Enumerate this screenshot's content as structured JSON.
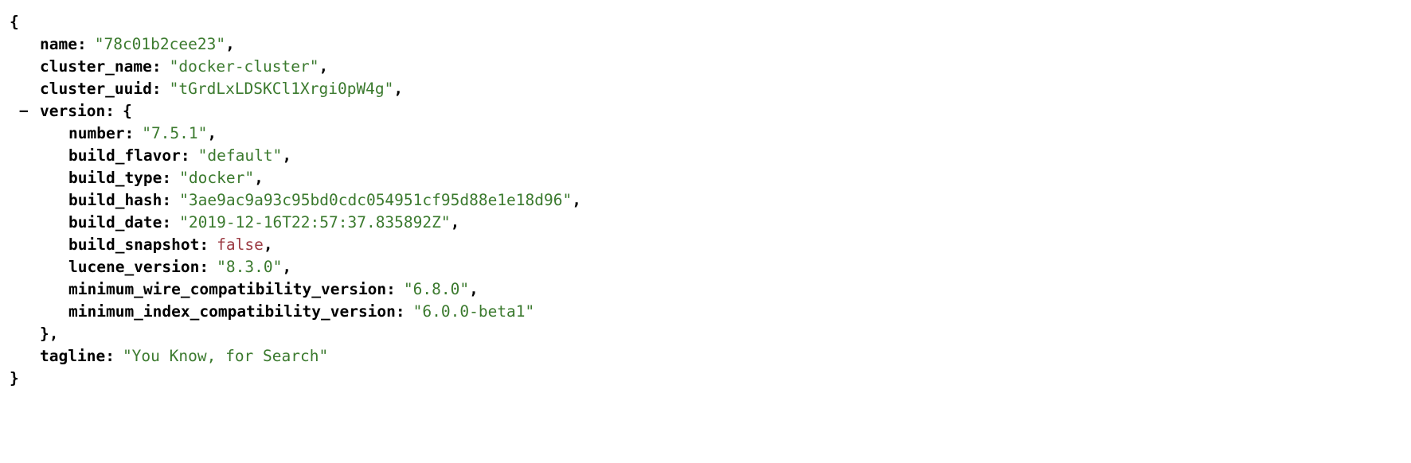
{
  "viewer": {
    "type": "json-viewer",
    "colors": {
      "background": "#ffffff",
      "key": "#000000",
      "string_value": "#3b7a2e",
      "boolean_value": "#9c3c44",
      "punctuation": "#000000"
    },
    "open_brace": "{",
    "close_brace": "}",
    "object_open": "{",
    "object_close_comma": "},",
    "collapse_toggle": "−",
    "colon": ":",
    "comma": ",",
    "quote": "\""
  },
  "document": {
    "root_open": "{",
    "root_close": "}",
    "entries": [
      {
        "key": "name",
        "value": "\"78c01b2cee23\"",
        "type": "string",
        "comma": ",",
        "indent": 1
      },
      {
        "key": "cluster_name",
        "value": "\"docker-cluster\"",
        "type": "string",
        "comma": ",",
        "indent": 1
      },
      {
        "key": "cluster_uuid",
        "value": "\"tGrdLxLDSKCl1Xrgi0pW4g\"",
        "type": "string",
        "comma": ",",
        "indent": 1
      },
      {
        "key": "version",
        "value": "{",
        "type": "object-open",
        "comma": "",
        "indent": 1,
        "toggle": "−"
      },
      {
        "key": "number",
        "value": "\"7.5.1\"",
        "type": "string",
        "comma": ",",
        "indent": 2
      },
      {
        "key": "build_flavor",
        "value": "\"default\"",
        "type": "string",
        "comma": ",",
        "indent": 2
      },
      {
        "key": "build_type",
        "value": "\"docker\"",
        "type": "string",
        "comma": ",",
        "indent": 2
      },
      {
        "key": "build_hash",
        "value": "\"3ae9ac9a93c95bd0cdc054951cf95d88e1e18d96\"",
        "type": "string",
        "comma": ",",
        "indent": 2
      },
      {
        "key": "build_date",
        "value": "\"2019-12-16T22:57:37.835892Z\"",
        "type": "string",
        "comma": ",",
        "indent": 2
      },
      {
        "key": "build_snapshot",
        "value": "false",
        "type": "boolean",
        "comma": ",",
        "indent": 2
      },
      {
        "key": "lucene_version",
        "value": "\"8.3.0\"",
        "type": "string",
        "comma": ",",
        "indent": 2
      },
      {
        "key": "minimum_wire_compatibility_version",
        "value": "\"6.8.0\"",
        "type": "string",
        "comma": ",",
        "indent": 2
      },
      {
        "key": "minimum_index_compatibility_version",
        "value": "\"6.0.0-beta1\"",
        "type": "string",
        "comma": "",
        "indent": 2
      },
      {
        "key": "",
        "value": "},",
        "type": "object-close",
        "comma": "",
        "indent": 1
      },
      {
        "key": "tagline",
        "value": "\"You Know, for Search\"",
        "type": "string",
        "comma": "",
        "indent": 1
      }
    ]
  }
}
